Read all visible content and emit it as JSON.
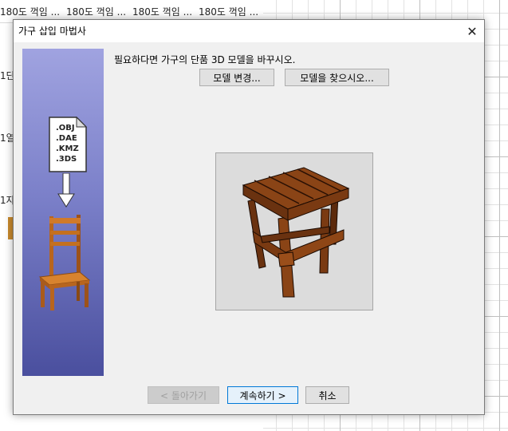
{
  "background": {
    "tabs": [
      "180도 꺽임 ...",
      "180도 꺽임 ...",
      "180도 꺽임 ...",
      "180도 꺽임 ..."
    ],
    "row_labels": [
      "1단",
      "1열",
      "1자"
    ]
  },
  "dialog": {
    "title": "가구 삽입 마법사",
    "close_glyph": "✕",
    "instruction": "필요하다면 가구의 단품 3D 모델을 바꾸시오.",
    "change_model_label": "모델 변경...",
    "find_model_label": "모델을 찾으시오...",
    "formats": [
      ".OBJ",
      ".DAE",
      ".KMZ",
      ".3DS"
    ],
    "back_label": "< 돌아가기",
    "next_label": "계속하기 >",
    "cancel_label": "취소"
  }
}
